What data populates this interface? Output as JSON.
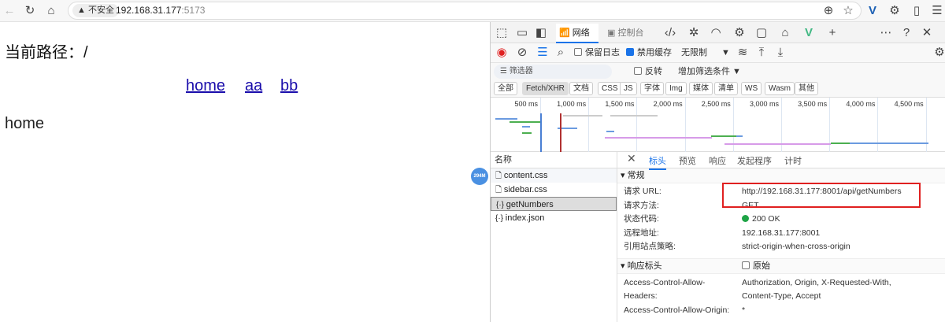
{
  "browser": {
    "insecure_label": "不安全",
    "url_host": "192.168.31.177",
    "url_port": ":5173"
  },
  "page": {
    "path_label": "当前路径：/",
    "links": [
      "home",
      "aa",
      "bb"
    ],
    "view_text": "home",
    "badge": "294M"
  },
  "devtools": {
    "tabs": {
      "network": "网络",
      "console": "控制台"
    },
    "toolbar": {
      "preserve_log": "保留日志",
      "disable_cache": "禁用缓存",
      "throttle": "无限制"
    },
    "filter": {
      "placeholder": "筛选器",
      "invert": "反转",
      "add_filter": "增加筛选条件"
    },
    "types": [
      "全部",
      "Fetch/XHR",
      "文档",
      "CSS",
      "JS",
      "字体",
      "Img",
      "媒体",
      "清单",
      "WS",
      "Wasm",
      "其他"
    ],
    "timeline_ticks": [
      "500 ms",
      "1,000 ms",
      "1,500 ms",
      "2,000 ms",
      "2,500 ms",
      "3,000 ms",
      "3,500 ms",
      "4,000 ms",
      "4,500 ms"
    ],
    "name_header": "名称",
    "requests": [
      "content.css",
      "sidebar.css",
      "getNumbers",
      "index.json"
    ],
    "detail_tabs": [
      "标头",
      "预览",
      "响应",
      "发起程序",
      "计时"
    ],
    "general": {
      "title": "常规",
      "rows": [
        {
          "k": "请求 URL:",
          "v": "http://192.168.31.177:8001/api/getNumbers"
        },
        {
          "k": "请求方法:",
          "v": "GET"
        },
        {
          "k": "状态代码:",
          "v": "200 OK"
        },
        {
          "k": "远程地址:",
          "v": "192.168.31.177:8001"
        },
        {
          "k": "引用站点策略:",
          "v": "strict-origin-when-cross-origin"
        }
      ]
    },
    "response_headers": {
      "title": "响应标头",
      "raw": "原始",
      "rows": [
        {
          "k": "Access-Control-Allow-",
          "v": "Authorization, Origin, X-Requested-With,"
        },
        {
          "k": "Headers:",
          "v": "Content-Type, Accept"
        },
        {
          "k": "Access-Control-Allow-Origin:",
          "v": "*"
        }
      ]
    }
  },
  "colors": {
    "accent": "#1a73e8",
    "highlight": "#e02020",
    "status_ok": "#1ea446"
  }
}
